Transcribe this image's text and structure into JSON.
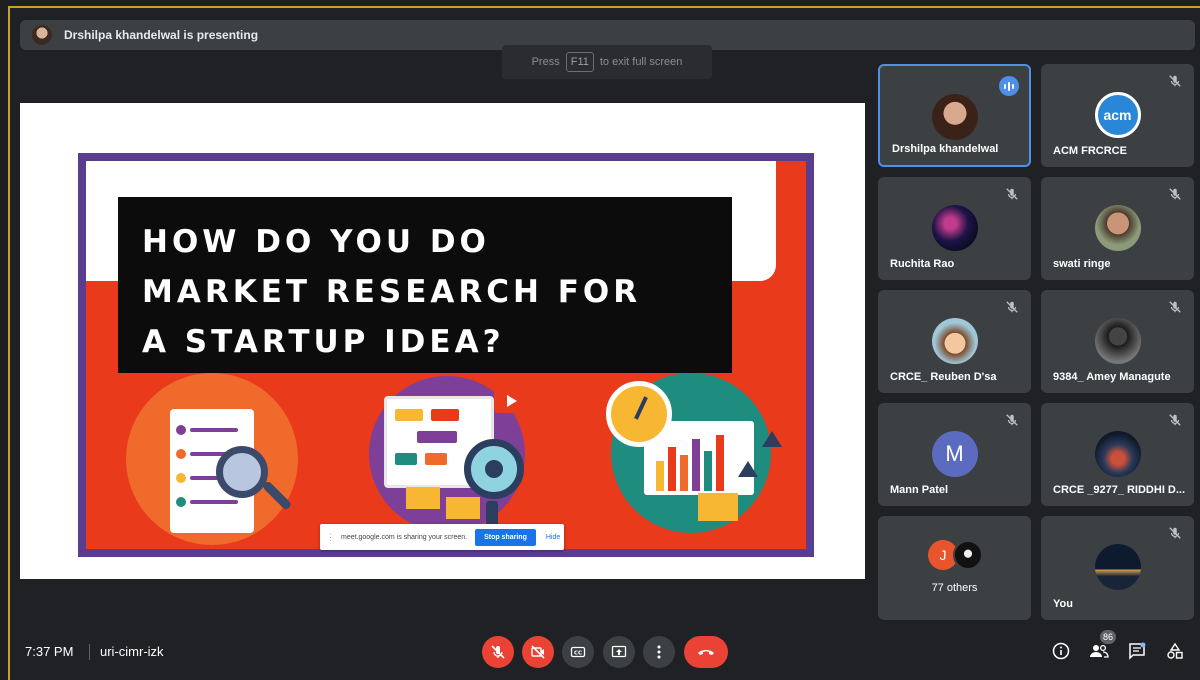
{
  "banner": {
    "text": "Drshilpa khandelwal is presenting"
  },
  "fullscreen_hint": {
    "press": "Press",
    "key": "F11",
    "rest": "to exit full screen"
  },
  "slide": {
    "title_lines": [
      "HOW DO YOU DO",
      "MARKET RESEARCH FOR",
      "A STARTUP IDEA?"
    ]
  },
  "share_bar": {
    "message": "meet.google.com is sharing your screen.",
    "stop_label": "Stop sharing",
    "hide_label": "Hide"
  },
  "participants": [
    {
      "name": "Drshilpa khandelwal",
      "state": "speaking",
      "avatar": "photo"
    },
    {
      "name": "ACM FRCRCE",
      "state": "muted",
      "avatar": "acm-logo",
      "logo_text": "acm"
    },
    {
      "name": "Ruchita Rao",
      "state": "muted",
      "avatar": "photo"
    },
    {
      "name": "swati ringe",
      "state": "muted",
      "avatar": "photo"
    },
    {
      "name": "CRCE_ Reuben D'sa",
      "state": "muted",
      "avatar": "photo"
    },
    {
      "name": "9384_ Amey Managute",
      "state": "muted",
      "avatar": "photo"
    },
    {
      "name": "Mann Patel",
      "state": "muted",
      "avatar": "letter",
      "letter": "M"
    },
    {
      "name": "CRCE _9277_ RIDDHI D...",
      "state": "muted",
      "avatar": "photo"
    },
    {
      "name": "77 others",
      "state": "none",
      "avatar": "group",
      "letter": "J"
    },
    {
      "name": "You",
      "state": "muted",
      "avatar": "photo"
    }
  ],
  "bottom": {
    "time": "7:37 PM",
    "meeting_code": "uri-cimr-izk",
    "people_count": "86"
  },
  "colors": {
    "accent_blue": "#4f8fe8",
    "danger_red": "#ea4335",
    "tile_bg": "#3c4043",
    "bg": "#202124"
  }
}
